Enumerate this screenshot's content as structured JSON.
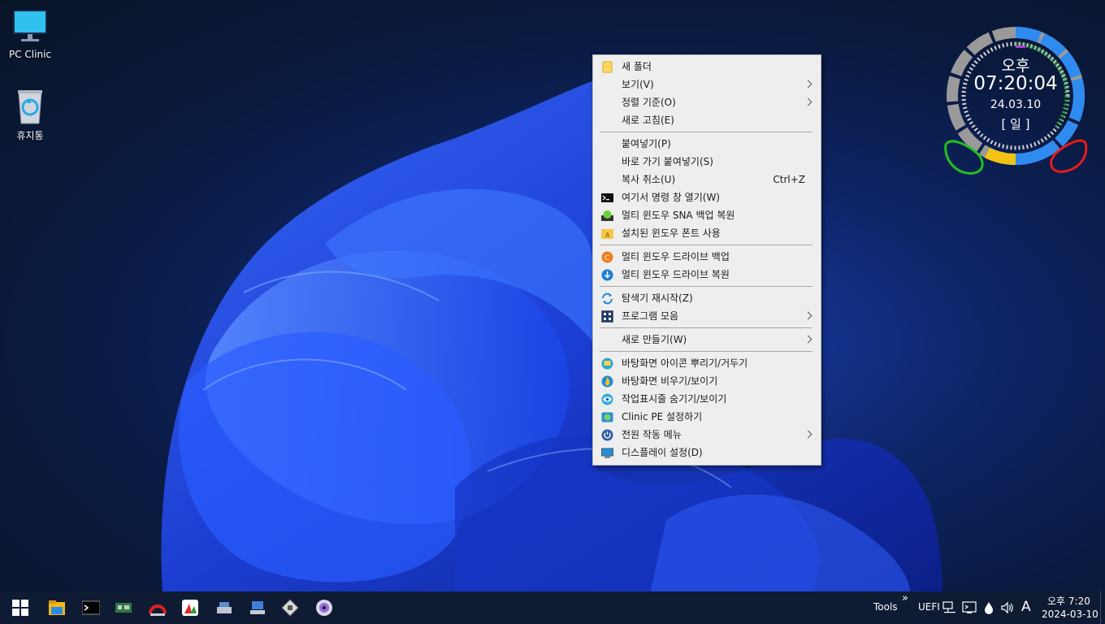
{
  "desktop": {
    "icons": [
      {
        "label": "PC Clinic",
        "icon": "monitor-icon"
      },
      {
        "label": "휴지통",
        "icon": "recycle-bin-icon"
      }
    ]
  },
  "context_menu": {
    "items": [
      {
        "label": "새 폴더",
        "icon": "folder-icon"
      },
      {
        "label": "보기(V)",
        "submenu": true
      },
      {
        "label": "정렬 기준(O)",
        "submenu": true
      },
      {
        "label": "새로 고침(E)"
      },
      {
        "label": "붙여넣기(P)"
      },
      {
        "label": "바로 가기 붙여넣기(S)"
      },
      {
        "label": "복사 취소(U)",
        "shortcut": "Ctrl+Z"
      },
      {
        "label": "여기서 명령 창 열기(W)",
        "icon": "cmd-icon"
      },
      {
        "label": "멀티 윈도우 SNA 백업 복원",
        "icon": "sna-restore-icon"
      },
      {
        "label": "설치된 윈도우 폰트 사용",
        "icon": "font-folder-icon"
      },
      {
        "label": "멀티 윈도우 드라이브 백업",
        "icon": "drive-backup-icon"
      },
      {
        "label": "멀티 윈도우 드라이브 복원",
        "icon": "drive-restore-icon"
      },
      {
        "label": "탐색기 재시작(Z)",
        "icon": "refresh-icon"
      },
      {
        "label": "프로그램 모음",
        "icon": "program-collection-icon",
        "submenu": true
      },
      {
        "label": "새로 만들기(W)",
        "submenu": true
      },
      {
        "label": "바탕화면 아이콘 뿌리기/거두기",
        "icon": "desktop-icons-icon"
      },
      {
        "label": "바탕화면 비우기/보이기",
        "icon": "fire-icon"
      },
      {
        "label": "작업표시줄 숨기기/보이기",
        "icon": "eye-icon"
      },
      {
        "label": "Clinic PE 설정하기",
        "icon": "settings-globe-icon"
      },
      {
        "label": "전원 작동 메뉴",
        "icon": "power-icon",
        "submenu": true
      },
      {
        "label": "디스플레이 설정(D)",
        "icon": "display-icon"
      }
    ]
  },
  "clock_widget": {
    "ampm": "오후",
    "time": "07:20:04",
    "date": "24.03.10",
    "weekday": "[ 일 ]"
  },
  "taskbar": {
    "pinned": [
      "start-icon",
      "file-explorer-icon",
      "terminal-icon",
      "hardware-card-icon",
      "speed-gauge-icon",
      "chart-app-icon",
      "drive-tools-icon",
      "network-icon",
      "disk-tool-icon",
      "cd-disc-icon"
    ],
    "tools_label": "Tools",
    "overflow_label": "»",
    "uefi_label": "UEFI",
    "ime_label": "A",
    "clock_time": "오후 7:20",
    "clock_date": "2024-03-10"
  },
  "colors": {
    "menu_bg": "#eeeeee",
    "taskbar_bg": "#0f1b33",
    "accent_blue": "#2f8bf0"
  }
}
